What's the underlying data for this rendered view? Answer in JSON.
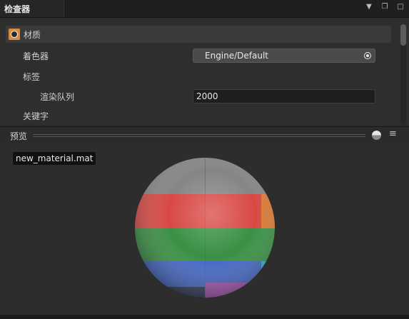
{
  "window": {
    "tab_title": "检查器",
    "icons": [
      "dropdown-icon",
      "restore-icon",
      "maximize-icon"
    ]
  },
  "section": {
    "label": "材质",
    "icon": "material-icon",
    "icon_color": "#d88a43"
  },
  "properties": {
    "shader_label": "着色器",
    "shader_value": "Engine/Default",
    "tags_label": "标签",
    "render_queue_label": "渲染队列",
    "render_queue_value": "2000",
    "keywords_label": "关键字"
  },
  "preview": {
    "title": "预览",
    "filename": "new_material.mat",
    "sphere_colors": [
      "#7f7f7f",
      "#d63f3a",
      "#2f8a3a",
      "#3a5fc2",
      "#9a4aa8",
      "#d8732a",
      "#2aa7c9"
    ]
  }
}
